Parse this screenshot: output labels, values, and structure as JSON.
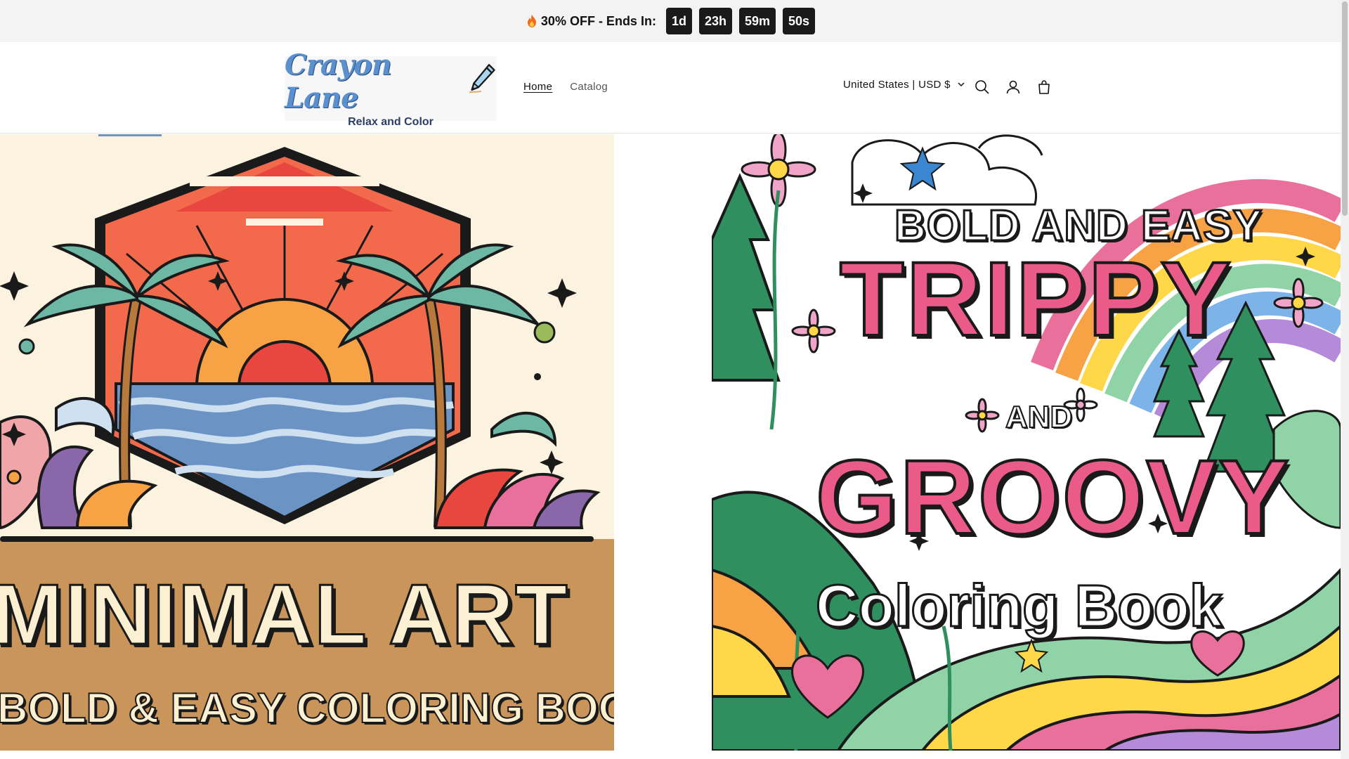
{
  "announcement": {
    "text": "30% OFF - Ends In:",
    "countdown": [
      "1d",
      "23h",
      "59m",
      "50s"
    ]
  },
  "header": {
    "logo_title": "Crayon Lane",
    "logo_tagline": "Relax and Color",
    "nav": [
      {
        "label": "Home",
        "active": true
      },
      {
        "label": "Catalog",
        "active": false
      }
    ],
    "country_currency": "United States | USD $",
    "icons": [
      "search-icon",
      "account-icon",
      "cart-icon"
    ]
  },
  "hero": {
    "left_card": {
      "title": "MINIMAL ART",
      "subtitle": "BOLD & EASY COLORING BOOK"
    },
    "right_card": {
      "line1": "BOLD AND EASY",
      "line2": "TRIPPY",
      "line3": "AND",
      "line4": "GROOVY",
      "line5": "Coloring Book"
    }
  },
  "colors": {
    "announcement_bg": "#f3f3f3",
    "countdown_bg": "#1a1a1a",
    "accent_pink": "#ea5b8a",
    "band_tan": "#c9955a"
  }
}
